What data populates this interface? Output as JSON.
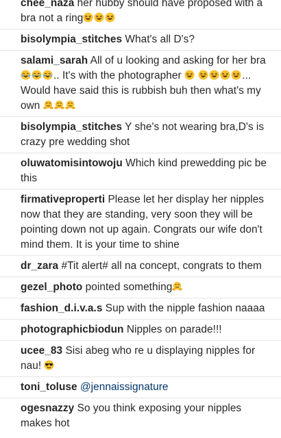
{
  "comments": [
    {
      "user": "chee_naza",
      "text": "her hubby should have proposed with a bra not a ring",
      "emojis": [
        "squint-laughing",
        "squint-laughing",
        "squint-laughing"
      ]
    },
    {
      "user": "bisolympia_stitches",
      "text": "What's all D's?"
    },
    {
      "user": "salami_sarah",
      "text_parts": [
        "All of u looking and asking for her bra",
        ".. It's with the photographer ",
        "... Would have said this is rubbish buh then what's my own "
      ]
    },
    {
      "user": "bisolympia_stitches",
      "text": "Y she's not wearing bra,D's is crazy pre wedding shot"
    },
    {
      "user": "oluwatomisintowoju",
      "text": "Which kind prewedding pic be this"
    },
    {
      "user": "firmativeproperti",
      "text": "Please let her display her nipples now that they are standing, very soon they will be pointing down not up again. Congrats our wife don't mind them. It is your time to shine"
    },
    {
      "user": "dr_zara",
      "text": "#Tit alert# all na concept, congrats to them"
    },
    {
      "user": "gezel_photo",
      "text": "pointed something"
    },
    {
      "user": "fashion_d.i.v.a.s",
      "text": "Sup with the nipple fashion naaaa"
    },
    {
      "user": "photographicbiodun",
      "text": "Nipples on parade!!!"
    },
    {
      "user": "ucee_83",
      "text": "Sisi abeg who re u displaying nipples for nau!"
    },
    {
      "user": "toni_toluse",
      "text": "@jennaissignature"
    },
    {
      "user": "ogesnazzy",
      "text": "So you think exposing your nipples makes hot"
    }
  ],
  "colors": {
    "username": "#262626",
    "text": "#262626",
    "mention": "#003569",
    "divider": "#e6e6e6",
    "emoji_face": "#f7c230"
  },
  "icons": {
    "squint-laughing": "😆",
    "tears-of-joy": "😂",
    "hugging-face": "🤗",
    "cool-sunglasses": "😎"
  }
}
